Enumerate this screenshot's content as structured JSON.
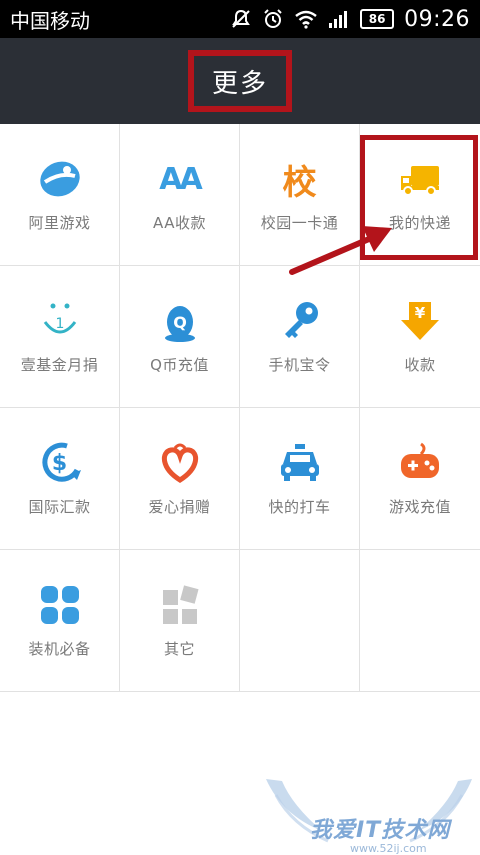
{
  "status_bar": {
    "carrier": "中国移动",
    "battery": "86",
    "time": "09:26"
  },
  "header": {
    "title": "更多"
  },
  "grid": {
    "items": [
      {
        "label": "阿里游戏",
        "icon": "ali-game-icon",
        "color": "#3a9de0"
      },
      {
        "label": "AA收款",
        "icon": "aa-icon",
        "color": "#3a9de0",
        "glyph": "AA"
      },
      {
        "label": "校园一卡通",
        "icon": "campus-card-icon",
        "color": "#f08a1c",
        "glyph": "校"
      },
      {
        "label": "我的快递",
        "icon": "truck-icon",
        "color": "#f5b400"
      },
      {
        "label": "壹基金月捐",
        "icon": "smile-one-icon",
        "color": "#33b3c6"
      },
      {
        "label": "Q币充值",
        "icon": "qq-penguin-icon",
        "color": "#2c8fd6"
      },
      {
        "label": "手机宝令",
        "icon": "key-icon",
        "color": "#2c8fd6"
      },
      {
        "label": "收款",
        "icon": "yuan-arrow-icon",
        "color": "#f5a600",
        "glyph": "¥"
      },
      {
        "label": "国际汇款",
        "icon": "dollar-arrow-icon",
        "color": "#2c8fd6",
        "glyph": "$"
      },
      {
        "label": "爱心捐赠",
        "icon": "heart-icon",
        "color": "#e8542e"
      },
      {
        "label": "快的打车",
        "icon": "taxi-icon",
        "color": "#2c8fd6"
      },
      {
        "label": "游戏充值",
        "icon": "gamepad-icon",
        "color": "#f0662a"
      },
      {
        "label": "装机必备",
        "icon": "apps-icon",
        "color": "#3a9de0"
      },
      {
        "label": "其它",
        "icon": "other-apps-icon",
        "color": "#c8c8c8"
      }
    ]
  },
  "annotation": {
    "color": "#b3141b"
  },
  "watermark": {
    "text": "我爱IT技术网",
    "url": "www.52ij.com"
  }
}
